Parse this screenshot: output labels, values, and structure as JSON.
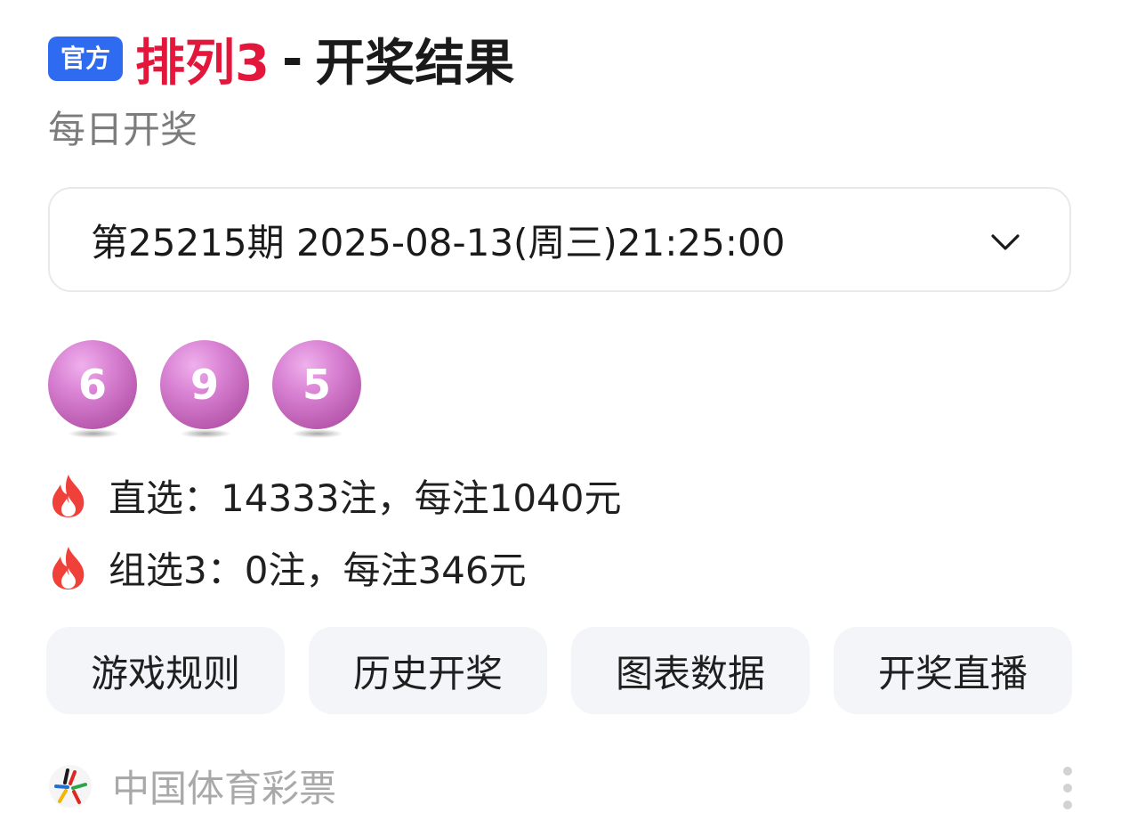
{
  "header": {
    "badge": "官方",
    "game_name": "排列3",
    "separator": "-",
    "title_suffix": "开奖结果",
    "subtitle": "每日开奖"
  },
  "issue_select": {
    "label": "第25215期 2025-08-13(周三)21:25:00",
    "icon": "chevron-down-icon"
  },
  "balls": [
    "6",
    "9",
    "5"
  ],
  "prizes": [
    {
      "icon": "fire-icon",
      "text": "直选：14333注，每注1040元"
    },
    {
      "icon": "fire-icon",
      "text": "组选3：0注，每注346元"
    }
  ],
  "buttons": [
    "游戏规则",
    "历史开奖",
    "图表数据",
    "开奖直播"
  ],
  "source": {
    "logo": "china-sports-lottery-logo",
    "name": "中国体育彩票",
    "more_icon": "more-vertical-icon"
  },
  "colors": {
    "badge_bg": "#2f6bf0",
    "game_name": "#e3173c",
    "ball": "#c96bc1",
    "fire": "#f0403a",
    "button_bg": "#f4f5f8"
  }
}
